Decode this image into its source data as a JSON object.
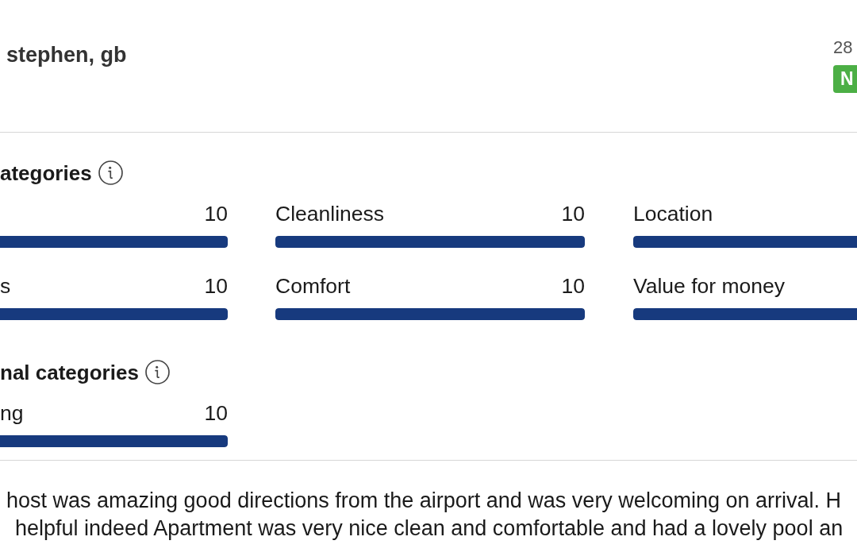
{
  "review_header": {
    "reviewer": "stephen, gb",
    "date": "28",
    "badge": "N"
  },
  "sections": [
    {
      "title": "ategories",
      "items": [
        {
          "value": "10",
          "level": 1
        },
        {
          "label": "Cleanliness",
          "value": "10",
          "level": 1
        },
        {
          "label": "Location",
          "level": 1
        },
        {
          "label": "s",
          "value": "10",
          "level": 1
        },
        {
          "label": "Comfort",
          "value": "10",
          "level": 1
        },
        {
          "label": "Value for money",
          "level": 1
        }
      ]
    },
    {
      "title": "nal categories",
      "items": [
        {
          "label": "ng",
          "value": "10",
          "level": 1
        }
      ]
    }
  ],
  "review_text": {
    "lines": [
      "host was amazing good directions from the airport and was very welcoming on arrival. H",
      "helpful indeed Apartment was very nice clean and comfortable and had a lovely pool an"
    ]
  }
}
